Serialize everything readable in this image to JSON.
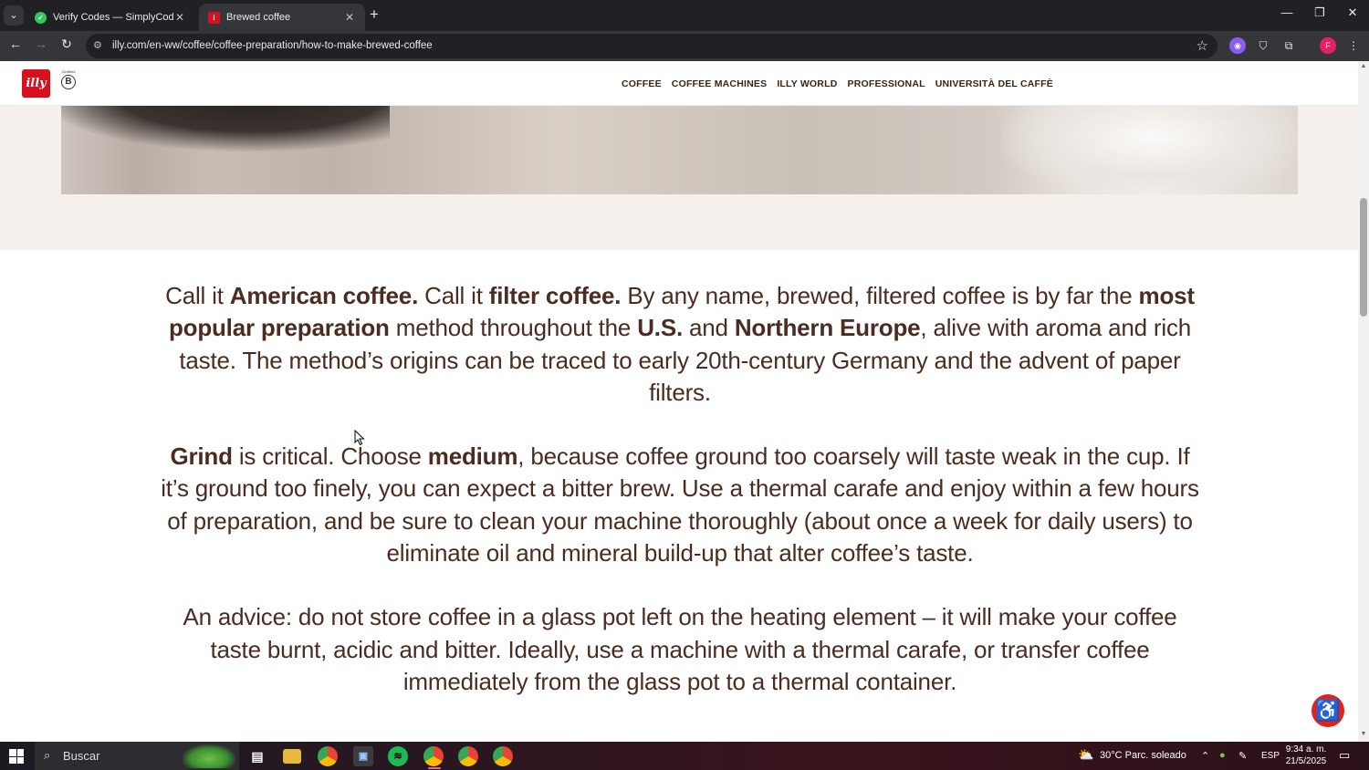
{
  "browser": {
    "tabs": [
      {
        "title": "Verify Codes — SimplyCodes",
        "active": false
      },
      {
        "title": "Brewed coffee",
        "active": true
      }
    ],
    "new_tab": "+",
    "url": "illy.com/en-ww/coffee/coffee-preparation/how-to-make-brewed-coffee",
    "profile_initial": "F"
  },
  "site": {
    "logo_text": "illy",
    "nav": [
      "COFFEE",
      "COFFEE MACHINES",
      "ILLY WORLD",
      "PROFESSIONAL",
      "UNIVERSITÀ DEL CAFFÈ"
    ]
  },
  "article": {
    "p1": [
      {
        "t": "Call it ",
        "b": false
      },
      {
        "t": "American coffee.",
        "b": true
      },
      {
        "t": " Call it ",
        "b": false
      },
      {
        "t": "filter coffee.",
        "b": true
      },
      {
        "t": " By any name, brewed, filtered coffee is by far the ",
        "b": false
      },
      {
        "t": "most popular preparation",
        "b": true
      },
      {
        "t": " method throughout the ",
        "b": false
      },
      {
        "t": "U.S.",
        "b": true
      },
      {
        "t": " and ",
        "b": false
      },
      {
        "t": "Northern Europe",
        "b": true
      },
      {
        "t": ", alive with aroma and rich taste.  The method’s origins can be traced to early 20th-century Germany and the advent of paper filters.",
        "b": false
      }
    ],
    "p2": [
      {
        "t": "Grind",
        "b": true
      },
      {
        "t": " is critical.  Choose ",
        "b": false
      },
      {
        "t": "medium",
        "b": true
      },
      {
        "t": ", because coffee ground too coarsely will taste weak in the cup. If it’s ground too finely, you can expect a bitter brew.  Use a thermal carafe and enjoy within a few hours of preparation, and be sure to clean your machine thoroughly (about once a week for daily users) to eliminate oil and mineral build-up that alter coffee’s taste.",
        "b": false
      }
    ],
    "p3": [
      {
        "t": "An advice: do not store coffee in a glass pot left on the heating element – it will make  your coffee taste burnt, acidic and bitter. Ideally, use a machine with a thermal carafe, or transfer coffee immediately from the glass pot to a thermal container.",
        "b": false
      }
    ]
  },
  "taskbar": {
    "search_placeholder": "Buscar",
    "weather": "30°C  Parc. soleado",
    "language": "ESP",
    "time": "9:34 a. m.",
    "date": "21/5/2025"
  },
  "colors": {
    "brand_red": "#d7101d",
    "text_brown": "#4a2c20",
    "hero_bg": "#f5f0ec"
  }
}
